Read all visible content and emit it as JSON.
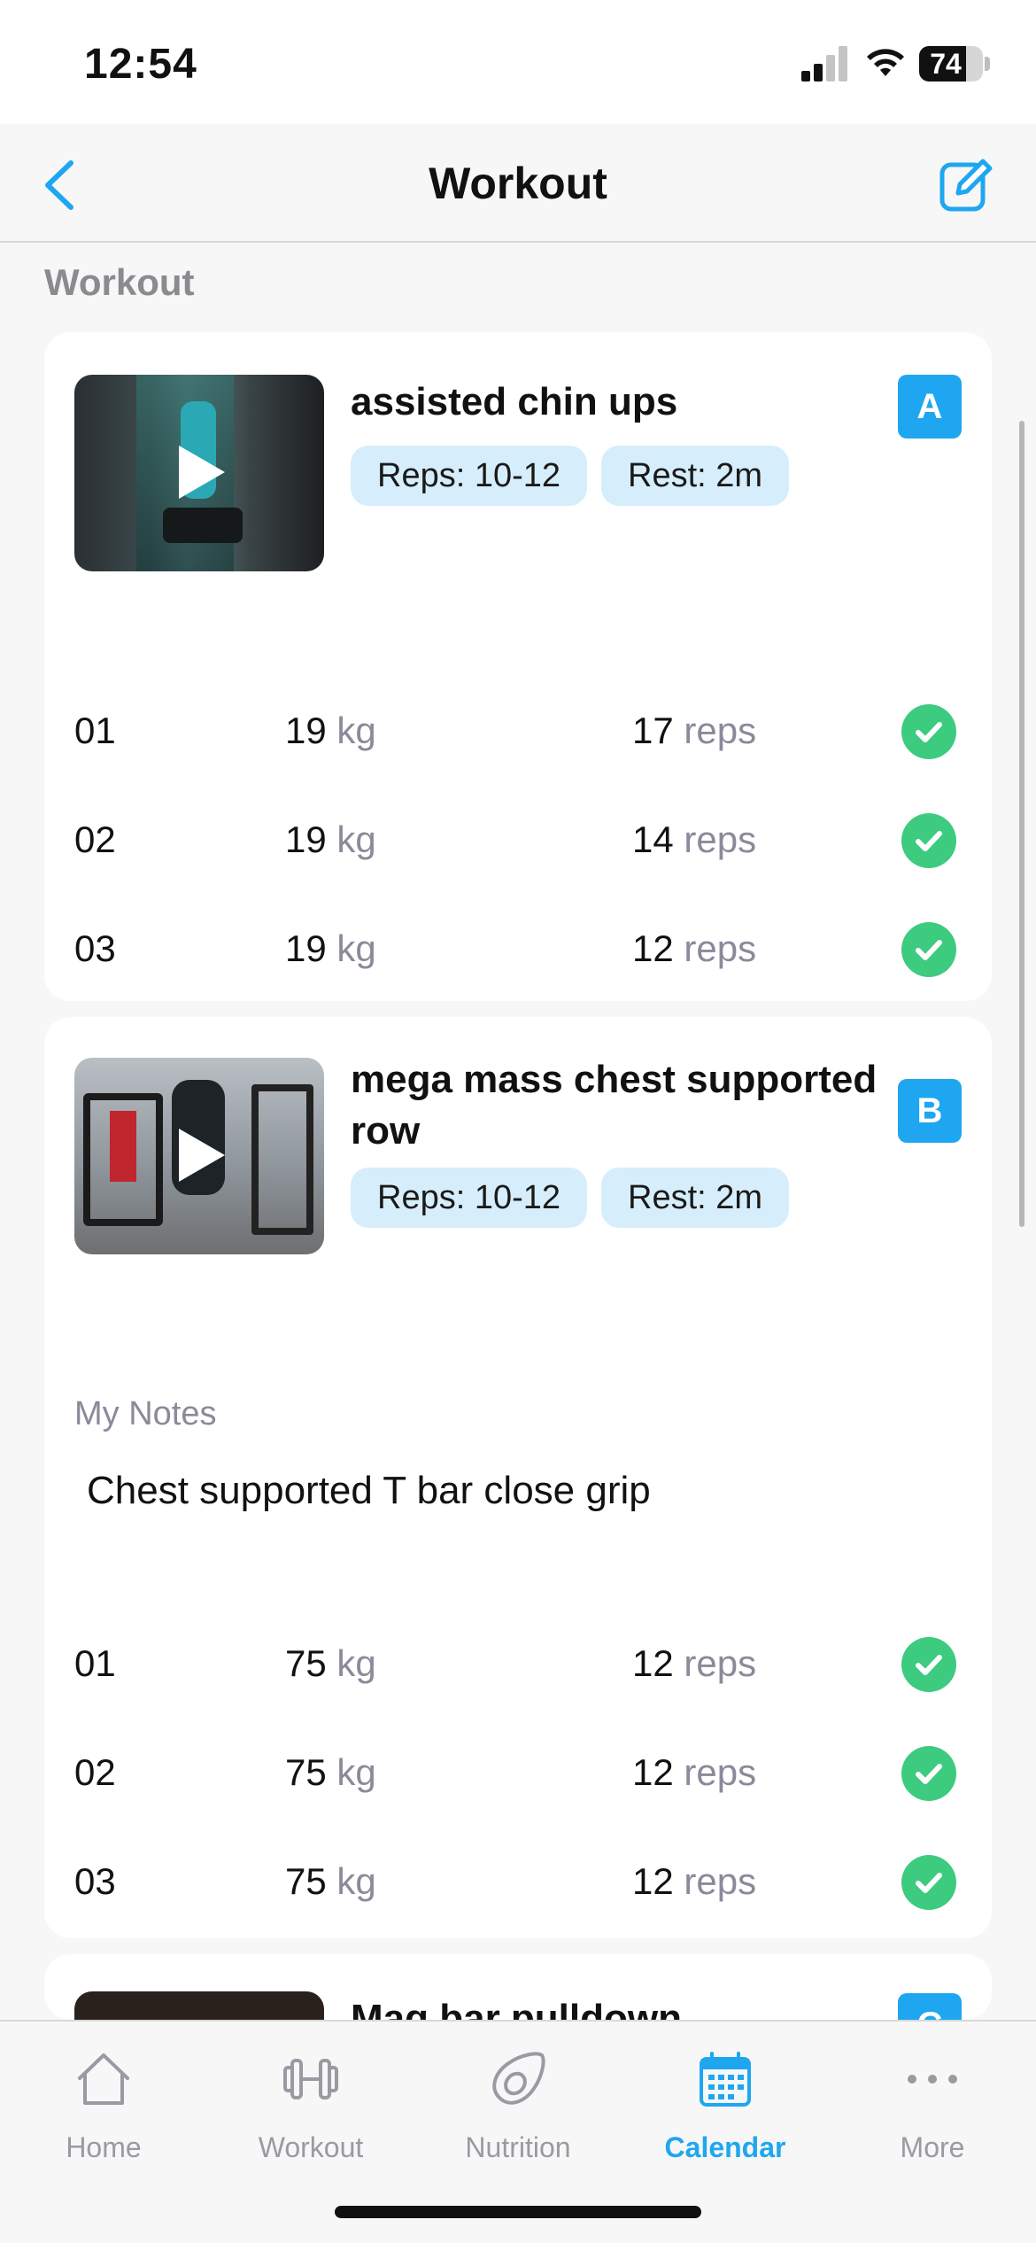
{
  "status": {
    "time": "12:54",
    "battery": "74",
    "battery_level": 0.74
  },
  "nav": {
    "title": "Workout"
  },
  "section_label": "Workout",
  "exercises": [
    {
      "name": "assisted chin ups",
      "reps_chip": "Reps: 10-12",
      "rest_chip": "Rest: 2m",
      "letter": "A",
      "sets": [
        {
          "num": "01",
          "weight": "19",
          "weight_unit": "kg",
          "reps": "17",
          "reps_unit": "reps",
          "done": true
        },
        {
          "num": "02",
          "weight": "19",
          "weight_unit": "kg",
          "reps": "14",
          "reps_unit": "reps",
          "done": true
        },
        {
          "num": "03",
          "weight": "19",
          "weight_unit": "kg",
          "reps": "12",
          "reps_unit": "reps",
          "done": true
        }
      ]
    },
    {
      "name": "mega mass chest supported row",
      "reps_chip": "Reps: 10-12",
      "rest_chip": "Rest: 2m",
      "letter": "B",
      "notes_label": "My Notes",
      "notes": "Chest supported T bar close grip",
      "sets": [
        {
          "num": "01",
          "weight": "75",
          "weight_unit": "kg",
          "reps": "12",
          "reps_unit": "reps",
          "done": true
        },
        {
          "num": "02",
          "weight": "75",
          "weight_unit": "kg",
          "reps": "12",
          "reps_unit": "reps",
          "done": true
        },
        {
          "num": "03",
          "weight": "75",
          "weight_unit": "kg",
          "reps": "12",
          "reps_unit": "reps",
          "done": true
        }
      ]
    },
    {
      "name": "Mag bar pulldown",
      "letter": "C"
    }
  ],
  "tabs": [
    {
      "label": "Home",
      "icon": "home-icon"
    },
    {
      "label": "Workout",
      "icon": "dumbbell-icon"
    },
    {
      "label": "Nutrition",
      "icon": "avocado-icon"
    },
    {
      "label": "Calendar",
      "icon": "calendar-icon",
      "active": true
    },
    {
      "label": "More",
      "icon": "more-icon"
    }
  ],
  "colors": {
    "accent": "#1ea7f0",
    "check": "#3ccb7f",
    "chip_bg": "#d6eefb"
  }
}
